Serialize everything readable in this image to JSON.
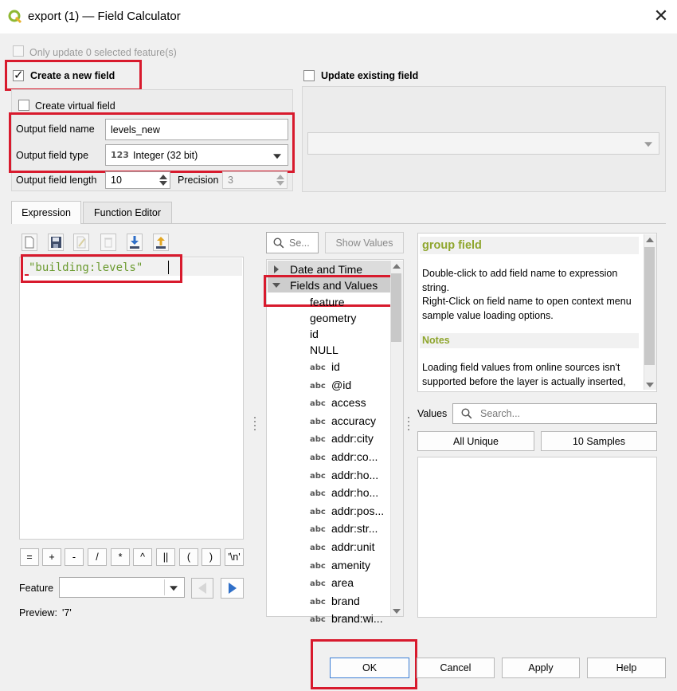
{
  "window": {
    "title": "export (1) — Field Calculator",
    "close_label": "✕"
  },
  "top": {
    "only_update_label": "Only update 0 selected feature(s)",
    "create_new_field_label": "Create a new field",
    "update_existing_label": "Update existing field",
    "create_virtual_label": "Create virtual field",
    "output_name_label": "Output field name",
    "output_name_value": "levels_new",
    "output_type_label": "Output field type",
    "output_type_icon": "123",
    "output_type_value": "Integer (32 bit)",
    "output_length_label": "Output field length",
    "output_length_value": "10",
    "precision_label": "Precision",
    "precision_value": "3",
    "existing_field_value": ""
  },
  "tabs": [
    {
      "label": "Expression"
    },
    {
      "label": "Function Editor"
    }
  ],
  "editor": {
    "toolbar_icons": [
      "new-file-icon",
      "save-icon",
      "edit-icon",
      "delete-icon",
      "import-icon",
      "export-icon"
    ],
    "expression": "\"building:levels\"",
    "operators": [
      "=",
      "+",
      "-",
      "/",
      "*",
      "^",
      "||",
      "(",
      ")",
      "'\\n'"
    ],
    "feature_label": "Feature",
    "feature_value": "",
    "preview_label": "Preview:",
    "preview_value": "'7'"
  },
  "functions": {
    "search_placeholder": "Se...",
    "show_values_label": "Show Values",
    "groups": [
      {
        "label": "Date and Time",
        "expanded": false
      },
      {
        "label": "Fields and Values",
        "expanded": true
      }
    ],
    "plain_items": [
      "feature",
      "geometry",
      "id",
      "NULL"
    ],
    "field_badge": "abc",
    "field_items": [
      "id",
      "@id",
      "access",
      "accuracy",
      "addr:city",
      "addr:co...",
      "addr:ho...",
      "addr:ho...",
      "addr:pos...",
      "addr:str...",
      "addr:unit",
      "amenity",
      "area",
      "brand",
      "brand:wi..."
    ]
  },
  "help": {
    "title": "group field",
    "line1": "Double-click to add field name to expression string.",
    "line2": "Right-Click on field name to open context menu sample value loading options.",
    "notes_heading": "Notes",
    "notes_text": "Loading field values from online sources isn't supported before the layer is actually inserted,"
  },
  "values": {
    "label": "Values",
    "search_placeholder": "Search...",
    "all_unique_label": "All Unique",
    "samples_label": "10 Samples"
  },
  "buttons": {
    "ok": "OK",
    "cancel": "Cancel",
    "apply": "Apply",
    "help": "Help"
  },
  "colors": {
    "highlight_red": "#d81a2d",
    "qgis_green": "#8fa62e",
    "expression_green": "#6a9a2e",
    "play_blue": "#2f6fc8"
  }
}
